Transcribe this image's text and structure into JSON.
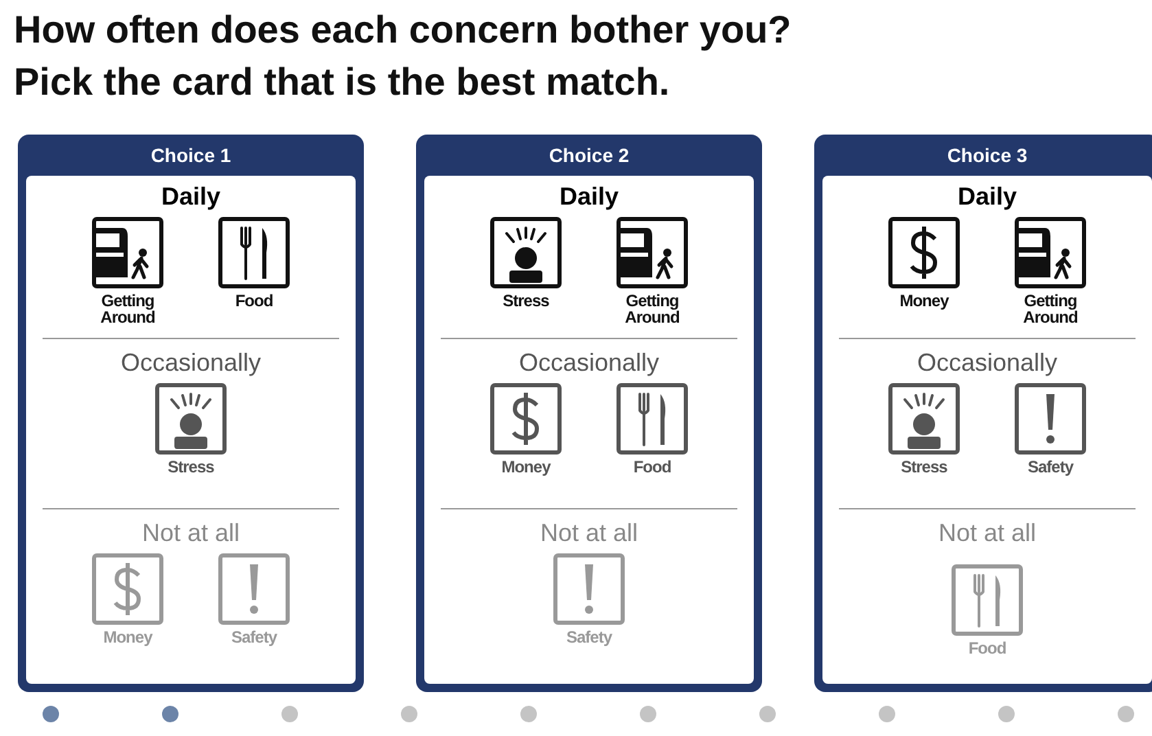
{
  "heading": [
    "How often does each concern bother you?",
    "Pick the card that is the best match."
  ],
  "cards": [
    {
      "title": "Choice 1",
      "sections": [
        {
          "label": "Daily",
          "items": [
            {
              "kind": "transport",
              "label": "Getting Around"
            },
            {
              "kind": "food",
              "label": "Food"
            }
          ]
        },
        {
          "label": "Occasionally",
          "items": [
            {
              "kind": "stress",
              "label": "Stress"
            }
          ]
        },
        {
          "label": "Not at all",
          "items": [
            {
              "kind": "money",
              "label": "Money"
            },
            {
              "kind": "safety",
              "label": "Safety"
            }
          ]
        }
      ]
    },
    {
      "title": "Choice 2",
      "sections": [
        {
          "label": "Daily",
          "items": [
            {
              "kind": "stress",
              "label": "Stress"
            },
            {
              "kind": "transport",
              "label": "Getting Around"
            }
          ]
        },
        {
          "label": "Occasionally",
          "items": [
            {
              "kind": "money",
              "label": "Money"
            },
            {
              "kind": "food",
              "label": "Food"
            }
          ]
        },
        {
          "label": "Not at all",
          "items": [
            {
              "kind": "safety",
              "label": "Safety"
            }
          ]
        }
      ]
    },
    {
      "title": "Choice 3",
      "sections": [
        {
          "label": "Daily",
          "items": [
            {
              "kind": "money",
              "label": "Money"
            },
            {
              "kind": "transport",
              "label": "Getting Around"
            }
          ]
        },
        {
          "label": "Occasionally",
          "items": [
            {
              "kind": "stress",
              "label": "Stress"
            },
            {
              "kind": "safety",
              "label": "Safety"
            }
          ]
        },
        {
          "label": "Not at all",
          "items": [
            {
              "kind": "food",
              "label": "Food"
            }
          ]
        }
      ]
    }
  ],
  "progress": [
    {
      "selected": true
    },
    {
      "selected": true
    },
    {
      "selected": false
    },
    {
      "selected": false
    },
    {
      "selected": false
    },
    {
      "selected": false
    },
    {
      "selected": false
    },
    {
      "selected": false
    },
    {
      "selected": false
    },
    {
      "selected": false
    }
  ]
}
